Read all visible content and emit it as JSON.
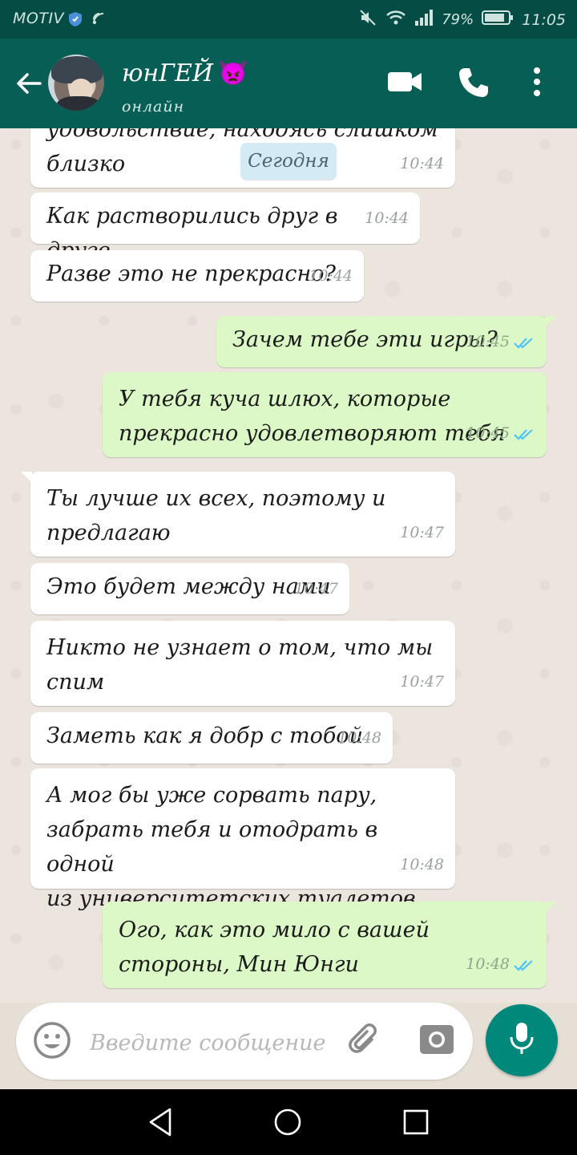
{
  "status_bar": {
    "carrier": "MOTIV",
    "battery": "79%",
    "time": "11:05"
  },
  "header": {
    "contact_name": "юнГЕЙ",
    "contact_status": "онлайн",
    "name_emoji": "👿"
  },
  "date_chip": "Сегодня",
  "messages": [
    {
      "dir": "in",
      "text_line1": "удовольствие, находясь слишком",
      "text_line2": "близко",
      "time": "10:44"
    },
    {
      "dir": "in",
      "text": "Как растворились друг в друге",
      "time": "10:44"
    },
    {
      "dir": "in",
      "text": "Разве это не прекрасно?",
      "time": "10:44"
    },
    {
      "dir": "out",
      "text": "Зачем тебе эти игры?",
      "time": "10:45",
      "status": "read"
    },
    {
      "dir": "out",
      "text_line1": "У тебя куча шлюх, которые",
      "text_line2": "прекрасно удовлетворяют тебя",
      "time": "10:45",
      "status": "read"
    },
    {
      "dir": "in",
      "text_line1": "Ты лучше их всех, поэтому и",
      "text_line2": "предлагаю",
      "time": "10:47"
    },
    {
      "dir": "in",
      "text": "Это будет между нами",
      "time": "10:47"
    },
    {
      "dir": "in",
      "text_line1": "Никто не узнает о том, что мы",
      "text_line2": "спим",
      "time": "10:47"
    },
    {
      "dir": "in",
      "text": "Заметь как я добр с тобой",
      "time": "10:48"
    },
    {
      "dir": "in",
      "text_line1": "А мог бы уже сорвать пару,",
      "text_line2": "забрать тебя и отодрать в одной",
      "text_line3": "из университетских туалетов",
      "time": "10:48"
    },
    {
      "dir": "out",
      "text_line1": "Ого, как это мило с вашей",
      "text_line2": "стороны, Мин Юнги",
      "time": "10:48",
      "status": "read"
    }
  ],
  "input": {
    "placeholder": "Введите сообщение"
  },
  "colors": {
    "header": "#075e54",
    "status_bar": "#054d44",
    "incoming": "#ffffff",
    "outgoing": "#dcf8c6",
    "read_ticks": "#4fc3f7",
    "mic_button": "#00897b"
  },
  "icons": [
    "back-arrow-icon",
    "video-call-icon",
    "phone-icon",
    "more-vert-icon",
    "emoji-icon",
    "attach-icon",
    "camera-icon",
    "mic-icon",
    "nav-back-icon",
    "nav-home-icon",
    "nav-recent-icon"
  ]
}
